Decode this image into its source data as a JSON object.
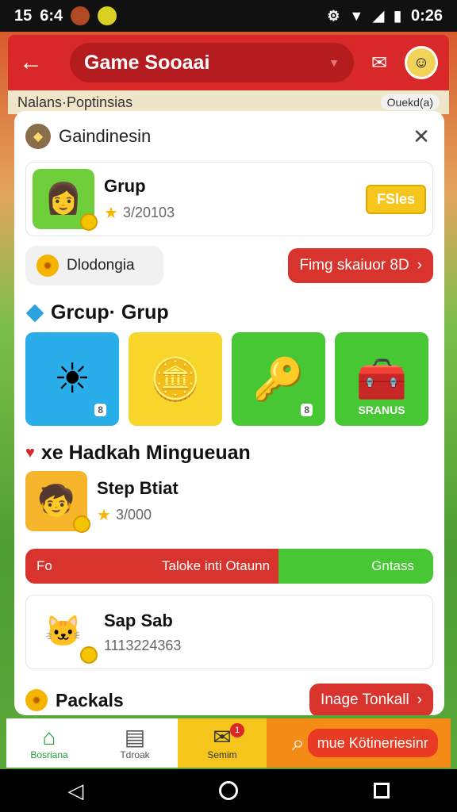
{
  "status_bar": {
    "time_left": "15",
    "time_mid": "6:4",
    "time_right": "0:26"
  },
  "app_bar": {
    "title": "Game Sooaai"
  },
  "under_strip": {
    "left_text": "Nalans·Poptinsias",
    "right_text": "Ouekd(a)"
  },
  "card": {
    "title": "Gaindinesin",
    "featured": {
      "name": "Grup",
      "score": "3/20103",
      "chip": "FSles"
    },
    "pill_label": "Dlodongia",
    "red_button": "Fimg skaiuor 8D",
    "section1_title": "Grcup· Grup",
    "tiles": [
      {
        "tag": "8",
        "color": "#2aaeea",
        "icon": "sun-icon"
      },
      {
        "tag": "",
        "color": "#f8d52a",
        "icon": "coin-icon"
      },
      {
        "tag": "8",
        "color": "#46c733",
        "icon": "key-icon"
      },
      {
        "tag": "SRANUS",
        "color": "#46c733",
        "icon": "chest-icon"
      }
    ],
    "section2_title": "xe Hadkah Mingueuan",
    "player": {
      "name": "Step Btiat",
      "score": "3/000"
    },
    "progress": {
      "left": "Fo",
      "mid": "Taloke inti Otaunn",
      "right": "Gntass",
      "fraction": 0.62
    },
    "pet": {
      "name": "Sap Sab",
      "id": "1113224363"
    },
    "bottom_label": "Packals",
    "bottom_button": "Inage Tonkall"
  },
  "bottom_nav": {
    "home": "Bosriana",
    "book": "Tdroak",
    "mail": "Semim",
    "mail_badge": "1",
    "search_pill": "mue Kötineriesinr"
  }
}
